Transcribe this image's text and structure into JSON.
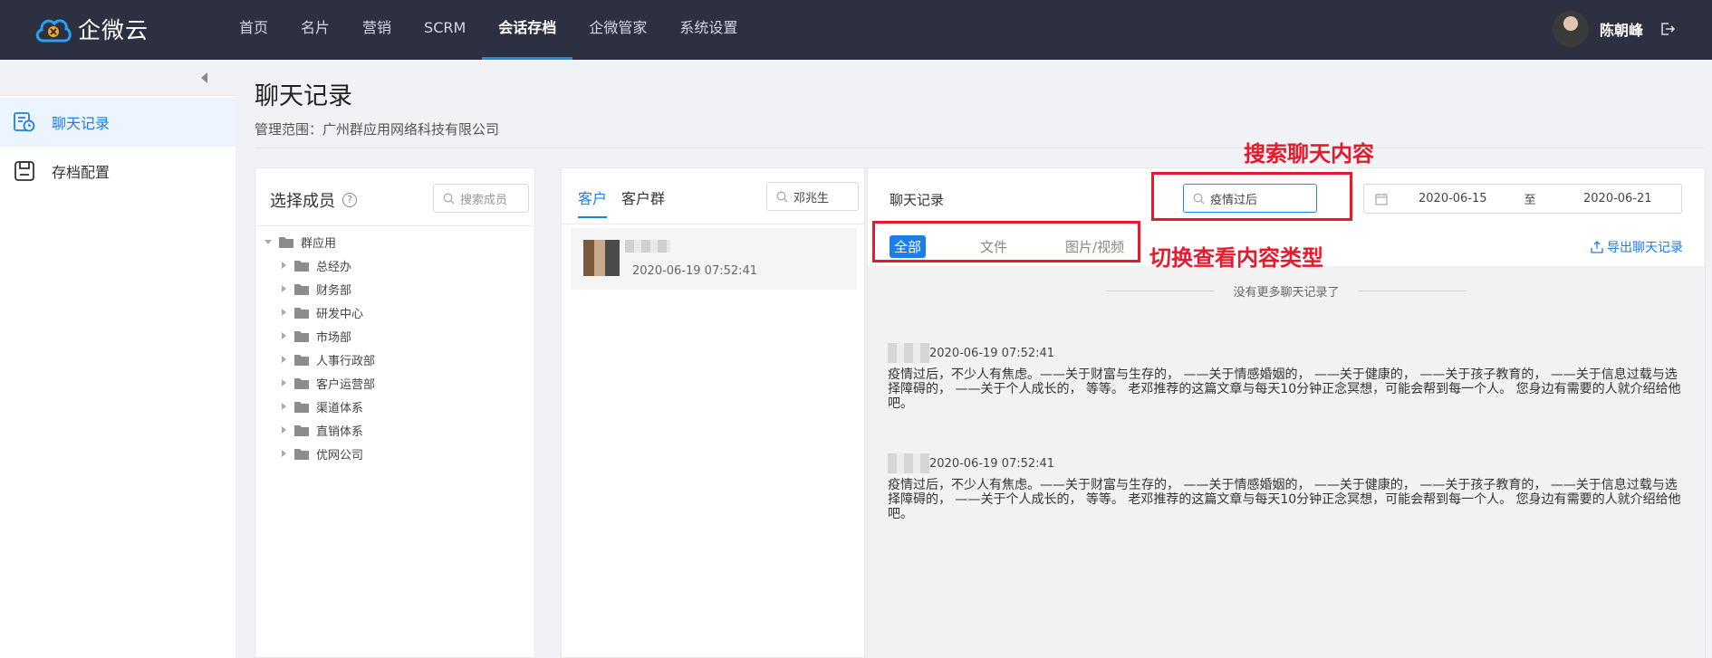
{
  "app": {
    "name": "企微云"
  },
  "nav": {
    "items": [
      "首页",
      "名片",
      "营销",
      "SCRM",
      "会话存档",
      "企微管家",
      "系统设置"
    ],
    "active_index": 4
  },
  "user": {
    "name": "陈朝峰"
  },
  "sidebar": {
    "items": [
      {
        "label": "聊天记录",
        "icon": "chat-record-icon",
        "active": true
      },
      {
        "label": "存档配置",
        "icon": "archive-config-icon",
        "active": false
      }
    ]
  },
  "page": {
    "title": "聊天记录",
    "scope": "管理范围：广州群应用网络科技有限公司"
  },
  "members": {
    "title": "选择成员",
    "help": "?",
    "search_placeholder": "搜索成员",
    "root": "群应用",
    "departments": [
      "总经办",
      "财务部",
      "研发中心",
      "市场部",
      "人事行政部",
      "客户运营部",
      "渠道体系",
      "直销体系",
      "优网公司"
    ]
  },
  "customers": {
    "tabs": [
      "客户",
      "客户群"
    ],
    "active_tab": 0,
    "search_value": "邓兆生",
    "items": [
      {
        "time": "2020-06-19 07:52:41"
      }
    ]
  },
  "chat": {
    "title": "聊天记录",
    "search_value": "疫情过后",
    "date_start": "2020-06-15",
    "date_to": "至",
    "date_end": "2020-06-21",
    "type_tabs": [
      "全部",
      "文件",
      "图片/视频"
    ],
    "active_type": 0,
    "export_label": "导出聊天记录",
    "no_more": "没有更多聊天记录了",
    "messages": [
      {
        "time": "2020-06-19 07:52:41",
        "text": "疫情过后，不少人有焦虑。——关于财富与生存的， ——关于情感婚姻的， ——关于健康的， ——关于孩子教育的， ——关于信息过载与选择障碍的， ——关于个人成长的， 等等。 老邓推荐的这篇文章与每天10分钟正念冥想，可能会帮到每一个人。 您身边有需要的人就介绍给他吧。"
      },
      {
        "time": "2020-06-19 07:52:41",
        "text": "疫情过后，不少人有焦虑。——关于财富与生存的， ——关于情感婚姻的， ——关于健康的， ——关于孩子教育的， ——关于信息过载与选择障碍的， ——关于个人成长的， 等等。 老邓推荐的这篇文章与每天10分钟正念冥想，可能会帮到每一个人。 您身边有需要的人就介绍给他吧。"
      }
    ]
  },
  "annotations": {
    "search_chat": "搜索聊天内容",
    "switch_type": "切换查看内容类型",
    "color": "#e8192c"
  },
  "colors": {
    "accent": "#1e7ee6",
    "topbar": "#2d3040"
  }
}
